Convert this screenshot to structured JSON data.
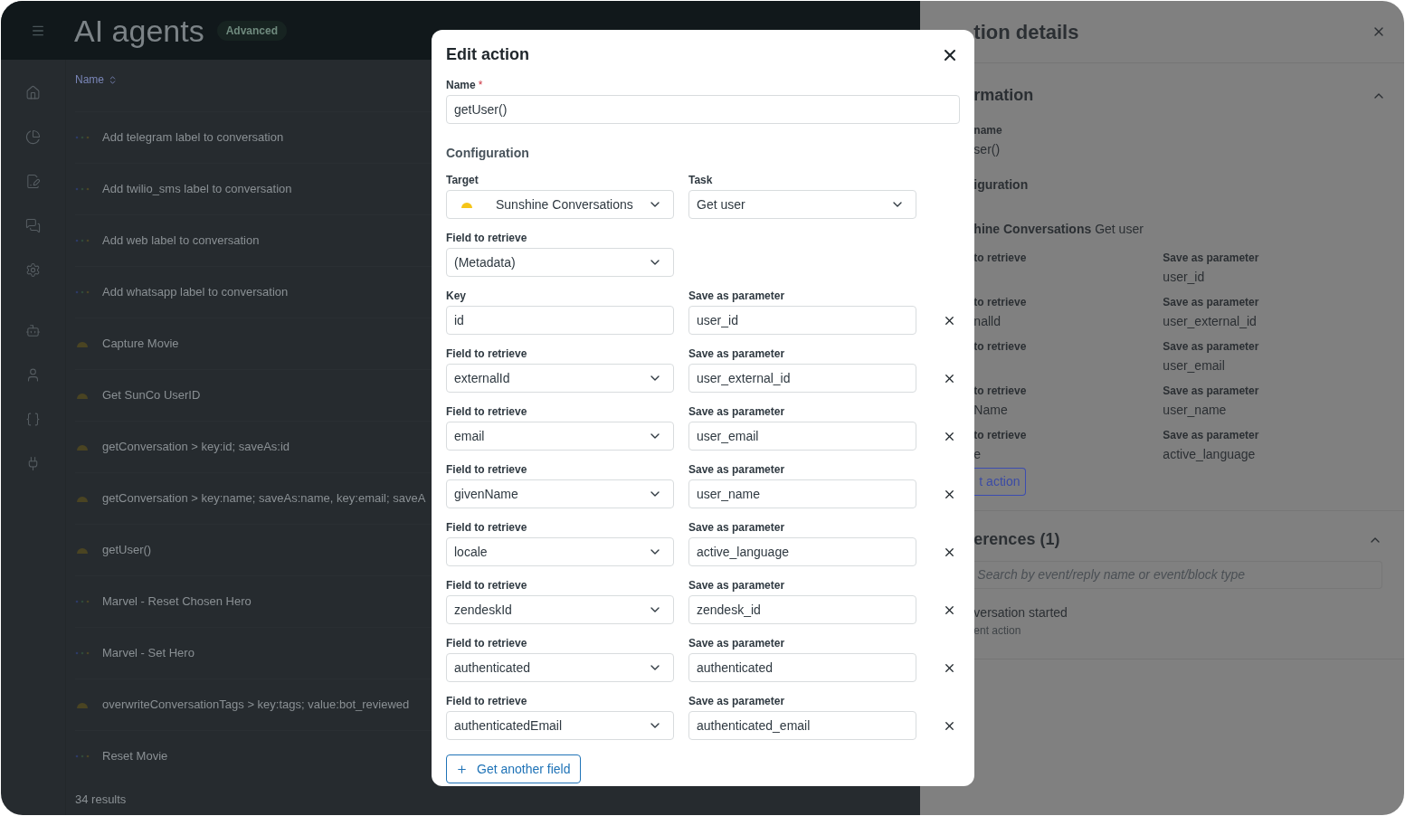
{
  "app": {
    "title": "AI agents",
    "badge": "Advanced"
  },
  "table": {
    "column": "Name",
    "rows": [
      {
        "kind": "flow",
        "name": "Add telegram label to conversation"
      },
      {
        "kind": "flow",
        "name": "Add twilio_sms label to conversation"
      },
      {
        "kind": "flow",
        "name": "Add web label to conversation"
      },
      {
        "kind": "flow",
        "name": "Add whatsapp label to conversation"
      },
      {
        "kind": "integration",
        "name": "Capture Movie"
      },
      {
        "kind": "integration",
        "name": "Get SunCo UserID"
      },
      {
        "kind": "integration",
        "name": "getConversation > key:id; saveAs:id"
      },
      {
        "kind": "integration",
        "name": "getConversation > key:name; saveAs:name, key:email; saveA"
      },
      {
        "kind": "integration",
        "name": "getUser()"
      },
      {
        "kind": "flow",
        "name": "Marvel - Reset Chosen Hero"
      },
      {
        "kind": "flow",
        "name": "Marvel - Set Hero"
      },
      {
        "kind": "integration",
        "name": "overwriteConversationTags > key:tags; value:bot_reviewed"
      },
      {
        "kind": "flow",
        "name": "Reset Movie"
      }
    ],
    "footer": "34 results"
  },
  "drawer": {
    "title": "tion details",
    "section": "rmation",
    "name_label": "name",
    "name_value": "ser()",
    "config_label": "iguration",
    "config_value": "**hine Conversations** Get user",
    "fields": [
      {
        "label": "to retrieve",
        "save_label": "Save as parameter",
        "save_value": "user_id"
      },
      {
        "label": "to retrieve",
        "value": "nalld",
        "save_label": "Save as parameter",
        "save_value": "user_external_id"
      },
      {
        "label": "to retrieve",
        "save_label": "Save as parameter",
        "save_value": "user_email"
      },
      {
        "label": "to retrieve",
        "value": "Name",
        "save_label": "Save as parameter",
        "save_value": "user_name"
      },
      {
        "label": "to retrieve",
        "value": "e",
        "save_label": "Save as parameter",
        "save_value": "active_language"
      }
    ],
    "edit_button": "t action",
    "references": "erences (1)",
    "search_placeholder": "Search by event/reply name or event/block type",
    "reference_title": "versation started",
    "reference_subtitle": "ent action"
  },
  "modal": {
    "title": "Edit action",
    "name_label": "Name",
    "required_mark": "*",
    "name_value": "getUser()",
    "section": "Configuration",
    "target_label": "Target",
    "target_value": "Sunshine Conversations",
    "task_label": "Task",
    "task_value": "Get user",
    "field_label": "Field to retrieve",
    "field_value": "(Metadata)",
    "rows": [
      {
        "kind": "key",
        "label": "Key",
        "value": "id",
        "save_label": "Save as parameter",
        "save_value": "user_id"
      },
      {
        "kind": "select",
        "label": "Field to retrieve",
        "value": "externalId",
        "save_label": "Save as parameter",
        "save_value": "user_external_id"
      },
      {
        "kind": "select",
        "label": "Field to retrieve",
        "value": "email",
        "save_label": "Save as parameter",
        "save_value": "user_email"
      },
      {
        "kind": "select",
        "label": "Field to retrieve",
        "value": "givenName",
        "save_label": "Save as parameter",
        "save_value": "user_name"
      },
      {
        "kind": "select",
        "label": "Field to retrieve",
        "value": "locale",
        "save_label": "Save as parameter",
        "save_value": "active_language"
      },
      {
        "kind": "select",
        "label": "Field to retrieve",
        "value": "zendeskId",
        "save_label": "Save as parameter",
        "save_value": "zendesk_id"
      },
      {
        "kind": "select",
        "label": "Field to retrieve",
        "value": "authenticated",
        "save_label": "Save as parameter",
        "save_value": "authenticated"
      },
      {
        "kind": "select",
        "label": "Field to retrieve",
        "value": "authenticatedEmail",
        "save_label": "Save as parameter",
        "save_value": "authenticated_email"
      }
    ],
    "add_button": "Get another field"
  }
}
